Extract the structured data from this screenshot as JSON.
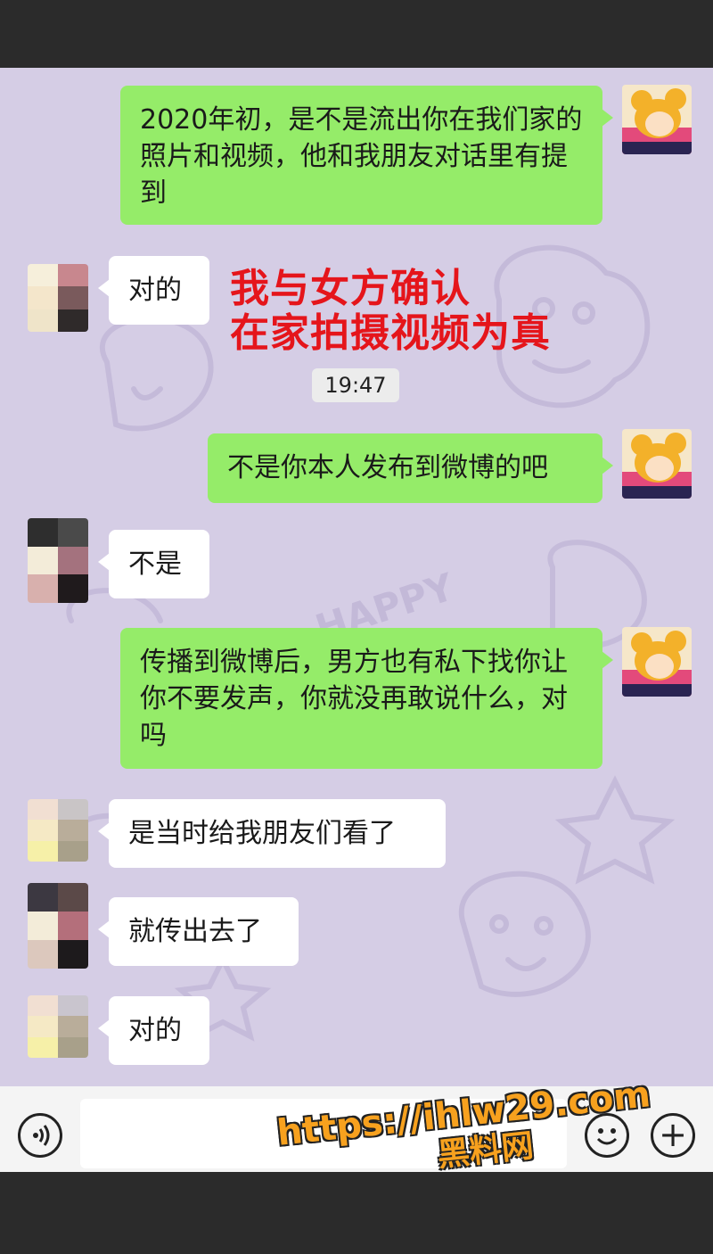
{
  "messages": [
    {
      "side": "out",
      "text": "2020年初，是不是流出你在我们家的照片和视频，他和我朋友对话里有提到"
    },
    {
      "side": "in",
      "text": "对的"
    },
    {
      "side": "out",
      "text": "不是你本人发布到微博的吧"
    },
    {
      "side": "in",
      "text": "不是"
    },
    {
      "side": "out",
      "text": "传播到微博后，男方也有私下找你让你不要发声，你就没再敢说什么，对吗"
    },
    {
      "side": "in",
      "text": "是当时给我朋友们看了"
    },
    {
      "side": "in",
      "text": "就传出去了"
    },
    {
      "side": "in",
      "text": "对的"
    }
  ],
  "timestamp": "19:47",
  "annotation": {
    "line1": "我与女方确认",
    "line2": "在家拍摄视频为真",
    "color": "#e5151b"
  },
  "background_text": "HAPPY",
  "input_bar": {
    "voice_icon": "voice-icon",
    "emoji_icon": "emoji-icon",
    "plus_icon": "plus-icon",
    "plus_glyph": "+"
  },
  "watermark": {
    "url": "https://ihlw29.com",
    "name": "黑料网"
  },
  "colors": {
    "outgoing_bubble": "#95ec69",
    "incoming_bubble": "#ffffff",
    "chat_background": "#d5cde5"
  }
}
